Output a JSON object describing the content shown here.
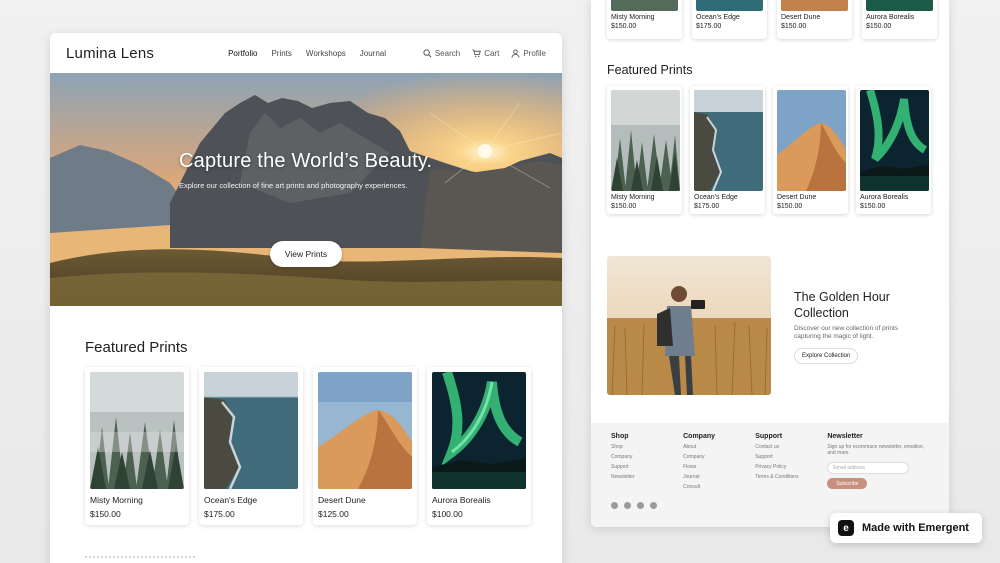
{
  "brand": "Lumina Lens",
  "nav": {
    "links": [
      "Portfolio",
      "Prints",
      "Workshops",
      "Journal"
    ],
    "search": "Search",
    "cart": "Cart",
    "profile": "Profile"
  },
  "hero": {
    "title": "Capture the World’s Beauty.",
    "subtitle": "Explore our collection of fine art prints and photography experiences.",
    "button": "View Prints"
  },
  "featured_left": {
    "heading": "Featured Prints",
    "items": [
      {
        "title": "Misty Morning",
        "price": "$150.00"
      },
      {
        "title": "Ocean's Edge",
        "price": "$175.00"
      },
      {
        "title": "Desert Dune",
        "price": "$125.00"
      },
      {
        "title": "Aurora Borealis",
        "price": "$100.00"
      }
    ]
  },
  "right": {
    "top_items": [
      {
        "title": "Misty Morning",
        "price": "$150.00"
      },
      {
        "title": "Ocean's Edge",
        "price": "$175.00"
      },
      {
        "title": "Desert Dune",
        "price": "$150.00"
      },
      {
        "title": "Aurora Borealis",
        "price": "$150.00"
      }
    ],
    "featured_heading": "Featured Prints",
    "featured_items": [
      {
        "title": "Misty Morning",
        "price": "$150.00"
      },
      {
        "title": "Ocean's Edge",
        "price": "$175.00"
      },
      {
        "title": "Desert Dune",
        "price": "$150.00"
      },
      {
        "title": "Aurora Borealis",
        "price": "$150.00"
      }
    ],
    "golden": {
      "title": "The Golden Hour Collection",
      "desc": "Discover our new collection of prints capturing the magic of light.",
      "button": "Explore Collection"
    },
    "footer": {
      "shop": {
        "heading": "Shop",
        "items": [
          "Shop",
          "Company",
          "Support",
          "Newsletter"
        ]
      },
      "company": {
        "heading": "Company",
        "items": [
          "About",
          "Company",
          "Flows",
          "Journal",
          "Consult"
        ]
      },
      "support": {
        "heading": "Support",
        "items": [
          "Contact us",
          "Support",
          "Privacy Policy",
          "Terms & Conditions"
        ]
      },
      "newsletter": {
        "heading": "Newsletter",
        "text": "Sign up for ecommace newsletter, emailion, and mare.",
        "placeholder": "Email address",
        "button": "Subscribe"
      }
    }
  },
  "badge": {
    "label": "Made with Emergent",
    "logo": "e"
  }
}
